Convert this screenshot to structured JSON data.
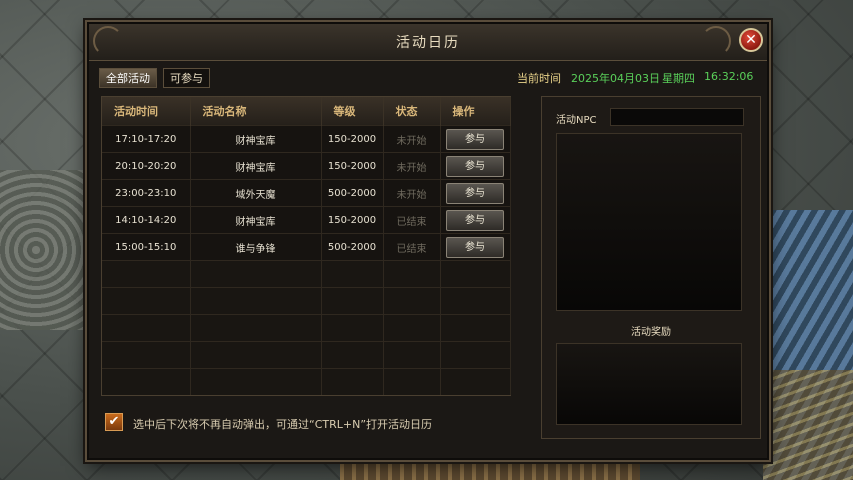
{
  "panel": {
    "title": "活动日历",
    "close_label": "✕"
  },
  "tabs": [
    {
      "label": "全部活动",
      "active": true
    },
    {
      "label": "可参与",
      "active": false
    }
  ],
  "clock": {
    "label": "当前时间",
    "date": "2025年04月03日",
    "weekday": "星期四",
    "time": "16:32:06"
  },
  "table": {
    "headers": [
      "活动时间",
      "活动名称",
      "等级",
      "状态",
      "操作"
    ],
    "rows": [
      {
        "time": "17:10-17:20",
        "name": "财神宝库",
        "level": "150-2000",
        "status": "未开始",
        "action": "参与"
      },
      {
        "time": "20:10-20:20",
        "name": "财神宝库",
        "level": "150-2000",
        "status": "未开始",
        "action": "参与"
      },
      {
        "time": "23:00-23:10",
        "name": "域外天魔",
        "level": "500-2000",
        "status": "未开始",
        "action": "参与"
      },
      {
        "time": "14:10-14:20",
        "name": "财神宝库",
        "level": "150-2000",
        "status": "已结束",
        "action": "参与"
      },
      {
        "time": "15:00-15:10",
        "name": "谁与争锋",
        "level": "500-2000",
        "status": "已结束",
        "action": "参与"
      }
    ]
  },
  "option": {
    "checked": true,
    "check_glyph": "✔",
    "label": "选中后下次将不再自动弹出，可通过“CTRL+N”打开活动日历"
  },
  "side": {
    "npc_label": "活动NPC",
    "reward_label": "活动奖励"
  },
  "colors": {
    "accent_gold": "#d9b77a",
    "time_green": "#5ad05a",
    "close_red": "#c8321f",
    "checkbox_orange": "#c96a1c"
  }
}
